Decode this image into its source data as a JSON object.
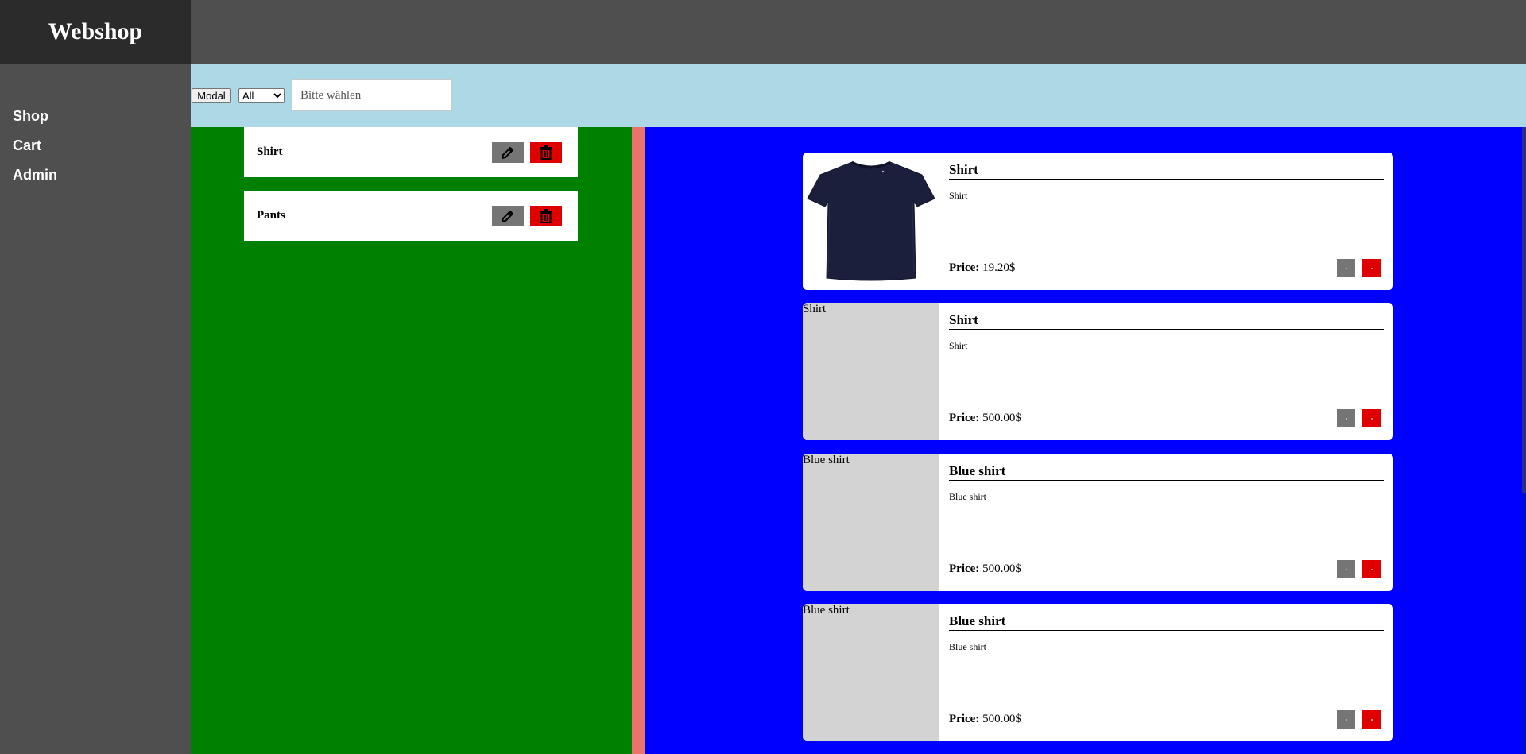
{
  "brand": {
    "title": "Webshop"
  },
  "nav": {
    "items": [
      {
        "label": "Shop"
      },
      {
        "label": "Cart"
      },
      {
        "label": "Admin"
      }
    ]
  },
  "toolbar": {
    "modal_label": "Modal",
    "filter": {
      "selected": "All"
    },
    "search": {
      "placeholder": "Bitte wählen"
    }
  },
  "admin": {
    "items": [
      {
        "name": "Shirt",
        "edit_icon": "pencil-icon",
        "delete_icon": "trash-icon"
      },
      {
        "name": "Pants",
        "edit_icon": "pencil-icon",
        "delete_icon": "trash-icon"
      }
    ]
  },
  "products": [
    {
      "title": "Shirt",
      "description": "Shirt",
      "price_label": "Price:",
      "price": "19.20$",
      "image_alt": "",
      "image": "t-shirt photo"
    },
    {
      "title": "Shirt",
      "description": "Shirt",
      "price_label": "Price:",
      "price": "500.00$",
      "image_alt": "Shirt"
    },
    {
      "title": "Blue shirt",
      "description": "Blue shirt",
      "price_label": "Price:",
      "price": "500.00$",
      "image_alt": "Blue shirt"
    },
    {
      "title": "Blue shirt",
      "description": "Blue shirt",
      "price_label": "Price:",
      "price": "500.00$",
      "image_alt": "Blue shirt"
    }
  ],
  "colors": {
    "sidebar": "#4f4f4f",
    "brand_bg": "#2b2b2b",
    "toolbar": "#add8e6",
    "admin_panel": "#008000",
    "divider": "#e9756a",
    "shop_panel": "#0000ff",
    "grey_button": "#757575",
    "red_button": "#e00000"
  }
}
